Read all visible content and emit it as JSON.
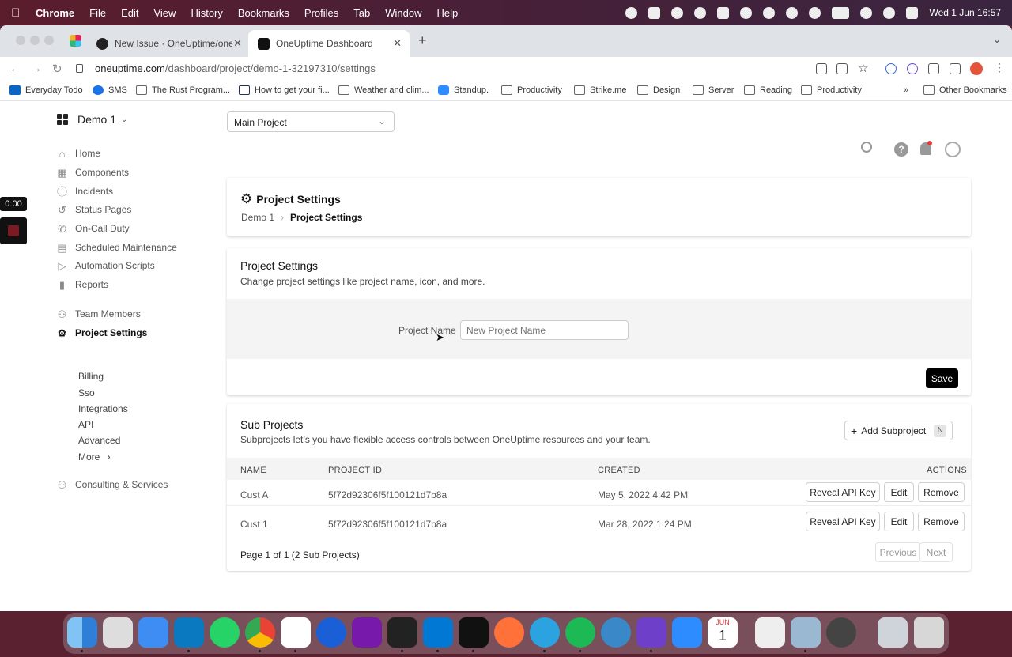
{
  "menubar": {
    "items": [
      "Chrome",
      "File",
      "Edit",
      "View",
      "History",
      "Bookmarks",
      "Profiles",
      "Tab",
      "Window",
      "Help"
    ],
    "datetime": "Wed 1 Jun  16:57"
  },
  "browser": {
    "tabs": [
      {
        "title": "New Issue · OneUptime/oneupti",
        "active": false
      },
      {
        "title": "OneUptime Dashboard",
        "active": true
      }
    ],
    "url_host": "oneuptime.com",
    "url_path": "/dashboard/project/demo-1-32197310/settings",
    "bookmarks": [
      "Everyday Todo",
      "SMS",
      "The Rust Program...",
      "How to get your fi...",
      "Weather and clim...",
      "Standup.",
      "Productivity",
      "Strike.me",
      "Design",
      "Server",
      "Reading",
      "Productivity"
    ],
    "bookmarks_overflow": "»",
    "other_bookmarks": "Other Bookmarks"
  },
  "recording": {
    "time": "0:00"
  },
  "sidebar": {
    "project_name": "Demo 1",
    "items": [
      {
        "label": "Home",
        "icon": "home-icon"
      },
      {
        "label": "Components",
        "icon": "components-icon"
      },
      {
        "label": "Incidents",
        "icon": "info-icon"
      },
      {
        "label": "Status Pages",
        "icon": "status-icon"
      },
      {
        "label": "On-Call Duty",
        "icon": "phone-icon"
      },
      {
        "label": "Scheduled Maintenance",
        "icon": "calendar-icon"
      },
      {
        "label": "Automation Scripts",
        "icon": "play-icon"
      },
      {
        "label": "Reports",
        "icon": "bar-chart-icon"
      },
      {
        "label": "Team Members",
        "icon": "team-icon"
      },
      {
        "label": "Project Settings",
        "icon": "gear-icon",
        "active": true
      },
      {
        "label": "Consulting & Services",
        "icon": "people-icon"
      }
    ],
    "subitems": [
      "Billing",
      "Sso",
      "Integrations",
      "API",
      "Advanced",
      "More"
    ]
  },
  "header": {
    "selected_project": "Main Project"
  },
  "title_card": {
    "title": "Project Settings",
    "breadcrumb": [
      "Demo 1",
      "Project Settings"
    ]
  },
  "settings_card": {
    "title": "Project Settings",
    "description": "Change project settings like project name, icon, and more.",
    "field_label": "Project Name",
    "field_placeholder": "New Project Name",
    "save_label": "Save"
  },
  "subprojects": {
    "title": "Sub Projects",
    "description": "Subprojects let’s you have flexible access controls between OneUptime resources and your team.",
    "add_label": "Add Subproject",
    "add_shortcut": "N",
    "columns": [
      "NAME",
      "PROJECT ID",
      "CREATED",
      "ACTIONS"
    ],
    "rows": [
      {
        "name": "Cust A",
        "id": "5f72d92306f5f100121d7b8a",
        "created": "May 5, 2022 4:42 PM"
      },
      {
        "name": "Cust 1",
        "id": "5f72d92306f5f100121d7b8a",
        "created": "Mar 28, 2022 1:24 PM"
      }
    ],
    "actions": {
      "reveal": "Reveal API Key",
      "edit": "Edit",
      "remove": "Remove"
    },
    "pagination": "Page 1 of 1 (2 Sub Projects)",
    "previous": "Previous",
    "next": "Next"
  },
  "dock": {
    "calendar_month": "JUN",
    "calendar_day": "1"
  }
}
